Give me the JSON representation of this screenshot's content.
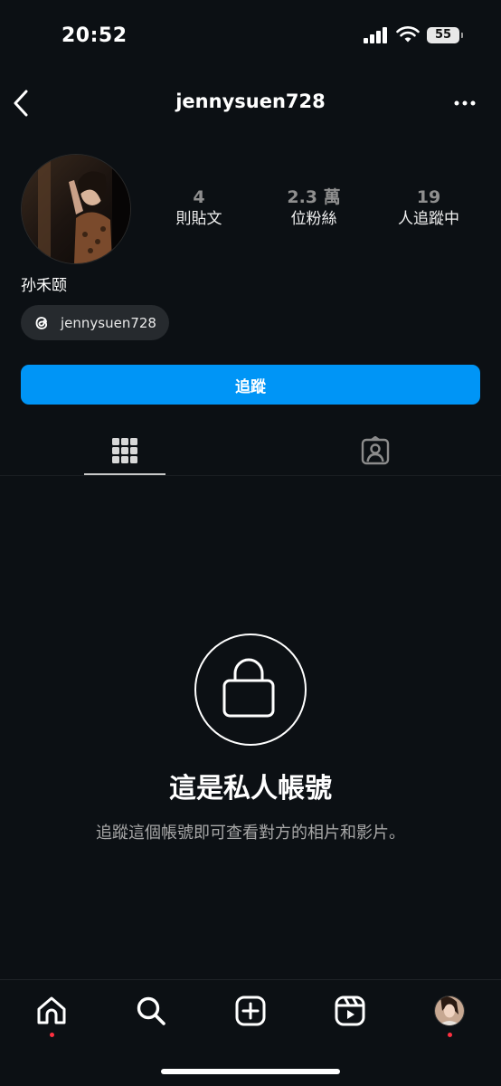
{
  "status_bar": {
    "time": "20:52",
    "battery": "55"
  },
  "header": {
    "username": "jennysuen728"
  },
  "profile": {
    "stats": [
      {
        "value": "4",
        "label": "則貼文"
      },
      {
        "value": "2.3 萬",
        "label": "位粉絲"
      },
      {
        "value": "19",
        "label": "人追蹤中"
      }
    ],
    "full_name": "孙禾颐",
    "threads_handle": "jennysuen728",
    "follow_label": "追蹤"
  },
  "private_account": {
    "title": "這是私人帳號",
    "subtitle": "追蹤這個帳號即可查看對方的相片和影片。"
  },
  "colors": {
    "background": "#0c1014",
    "accent": "#0095f6",
    "notification_dot": "#ff3040"
  },
  "icons": [
    "back-icon",
    "more-icon",
    "threads-icon",
    "grid-icon",
    "tagged-icon",
    "lock-icon",
    "home-icon",
    "search-icon",
    "create-icon",
    "reels-icon"
  ]
}
